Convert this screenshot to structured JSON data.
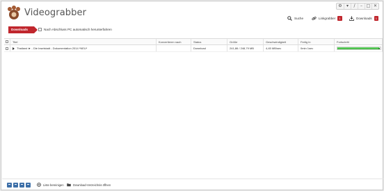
{
  "app": {
    "title": "Videograbber"
  },
  "window_controls": [
    "⚙",
    "▾",
    "/",
    "–",
    "□",
    "✕"
  ],
  "nav": {
    "search": {
      "label": "Suche",
      "icon": "search-icon"
    },
    "linkgrabber": {
      "label": "Linkgrabber",
      "count": "1",
      "icon": "link-icon"
    },
    "downloads": {
      "label": "Downloads",
      "count": "1",
      "icon": "download-icon"
    }
  },
  "toolbar": {
    "downloads_tab": "Downloads",
    "shutdown_label": "Nach Abschluss PC automatisch herunterfahren",
    "shutdown_checked": false
  },
  "table": {
    "headers": {
      "title": "Titel",
      "konvertieren": "Konvertieren nach",
      "status": "Status",
      "groesse": "Größe",
      "geschwindigkeit": "Geschwindigkeit",
      "fertig": "Fertig in",
      "fortschritt": "Fortschritt"
    },
    "rows": [
      {
        "title": "Thailand ► - Die Inselstadt - Dokumentation 2014 *NEU*",
        "konvertieren": "",
        "status": "Download",
        "groesse": "241,86 / 248,79 MB",
        "geschwindigkeit": "4,45 MB/sec",
        "fertig": "0min 1sec",
        "progress": 0.97
      }
    ]
  },
  "footer": {
    "clear_list": "Liste bereinigen",
    "open_folder": "Download-Verzeichnis öffnen"
  },
  "colors": {
    "accent": "#c0262d",
    "progress": "#32b032",
    "footer_buttons": "#3d6fa8"
  }
}
